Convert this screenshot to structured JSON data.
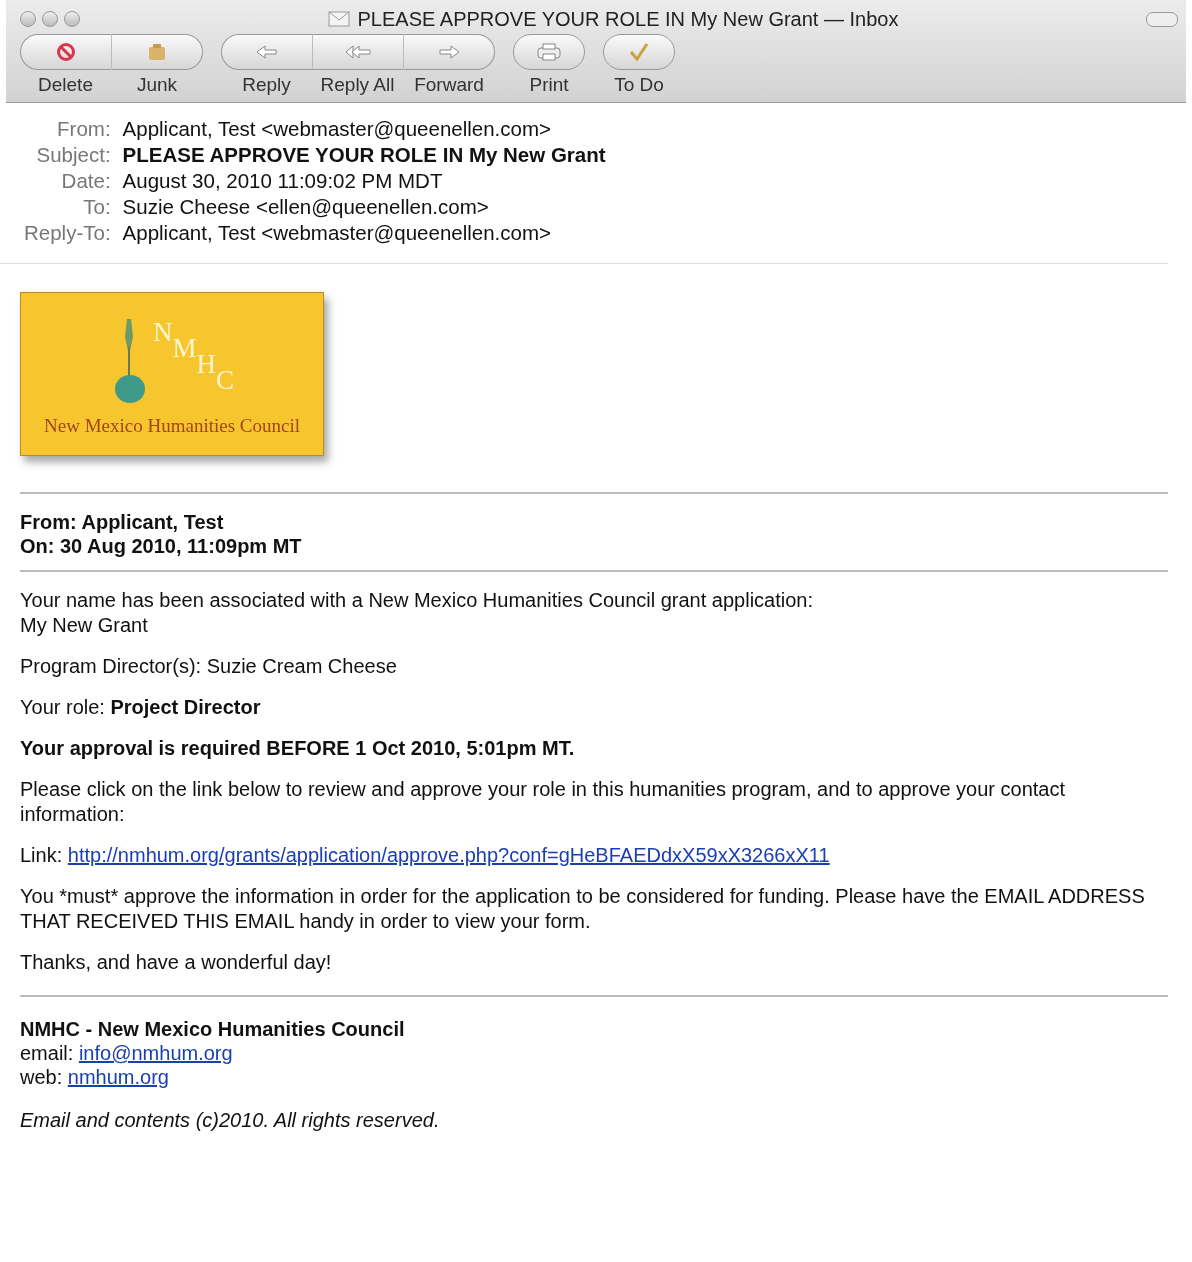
{
  "window": {
    "title": "PLEASE APPROVE YOUR ROLE IN My New Grant — Inbox"
  },
  "toolbar": [
    [
      {
        "kind": "delete",
        "label": "Delete"
      },
      {
        "kind": "junk",
        "label": "Junk"
      }
    ],
    [
      {
        "kind": "reply",
        "label": "Reply"
      },
      {
        "kind": "replyall",
        "label": "Reply All"
      },
      {
        "kind": "forward",
        "label": "Forward"
      }
    ],
    [
      {
        "kind": "print",
        "label": "Print"
      }
    ],
    [
      {
        "kind": "todo",
        "label": "To Do"
      }
    ]
  ],
  "headers": [
    {
      "label": "From:",
      "value": "Applicant, Test <webmaster@queenellen.com>",
      "bold": false
    },
    {
      "label": "Subject:",
      "value": "PLEASE APPROVE YOUR ROLE IN My New Grant",
      "bold": true
    },
    {
      "label": "Date:",
      "value": "August 30, 2010 11:09:02 PM MDT",
      "bold": false
    },
    {
      "label": "To:",
      "value": "Suzie Cheese <ellen@queenellen.com>",
      "bold": false
    },
    {
      "label": "Reply-To:",
      "value": "Applicant, Test <webmaster@queenellen.com>",
      "bold": false
    }
  ],
  "logo": {
    "letters": [
      "N",
      "M",
      "H",
      "C"
    ],
    "caption": "New Mexico Humanities Council"
  },
  "meta": [
    "From: Applicant, Test",
    "On: 30 Aug 2010, 11:09pm MT"
  ],
  "body": [
    {
      "kind": "text",
      "lines": [
        "Your name has been associated with a New Mexico Humanities Council grant application:",
        "My New Grant"
      ]
    },
    {
      "kind": "text",
      "lines": [
        "Program Director(s): Suzie Cream Cheese"
      ]
    },
    {
      "kind": "text",
      "lines": [
        "Your role: **Project Director**"
      ]
    },
    {
      "kind": "strong",
      "lines": [
        "Your approval is required BEFORE 1 Oct 2010, 5:01pm MT."
      ]
    },
    {
      "kind": "text",
      "lines": [
        "Please click on the link below to review and approve your role in this humanities program, and to approve your contact information:"
      ]
    },
    {
      "kind": "link",
      "label": "Link:",
      "url": "http://nmhum.org/grants/application/approve.php?conf=gHeBFAEDdxX59xX3266xX11"
    },
    {
      "kind": "plain",
      "lines": [
        "You *must* approve the information in order for the application to be considered for funding. Please have the EMAIL ADDRESS THAT RECEIVED THIS EMAIL handy in order to view your form."
      ]
    },
    {
      "kind": "text",
      "lines": [
        "Thanks, and have a wonderful day!"
      ]
    }
  ],
  "signature": {
    "org": "NMHC - New Mexico Humanities Council",
    "contacts": [
      {
        "label": "email:",
        "link": "info@nmhum.org"
      },
      {
        "label": "web:",
        "link": "nmhum.org"
      }
    ]
  },
  "footer": "Email and contents (c)2010. All rights reserved."
}
